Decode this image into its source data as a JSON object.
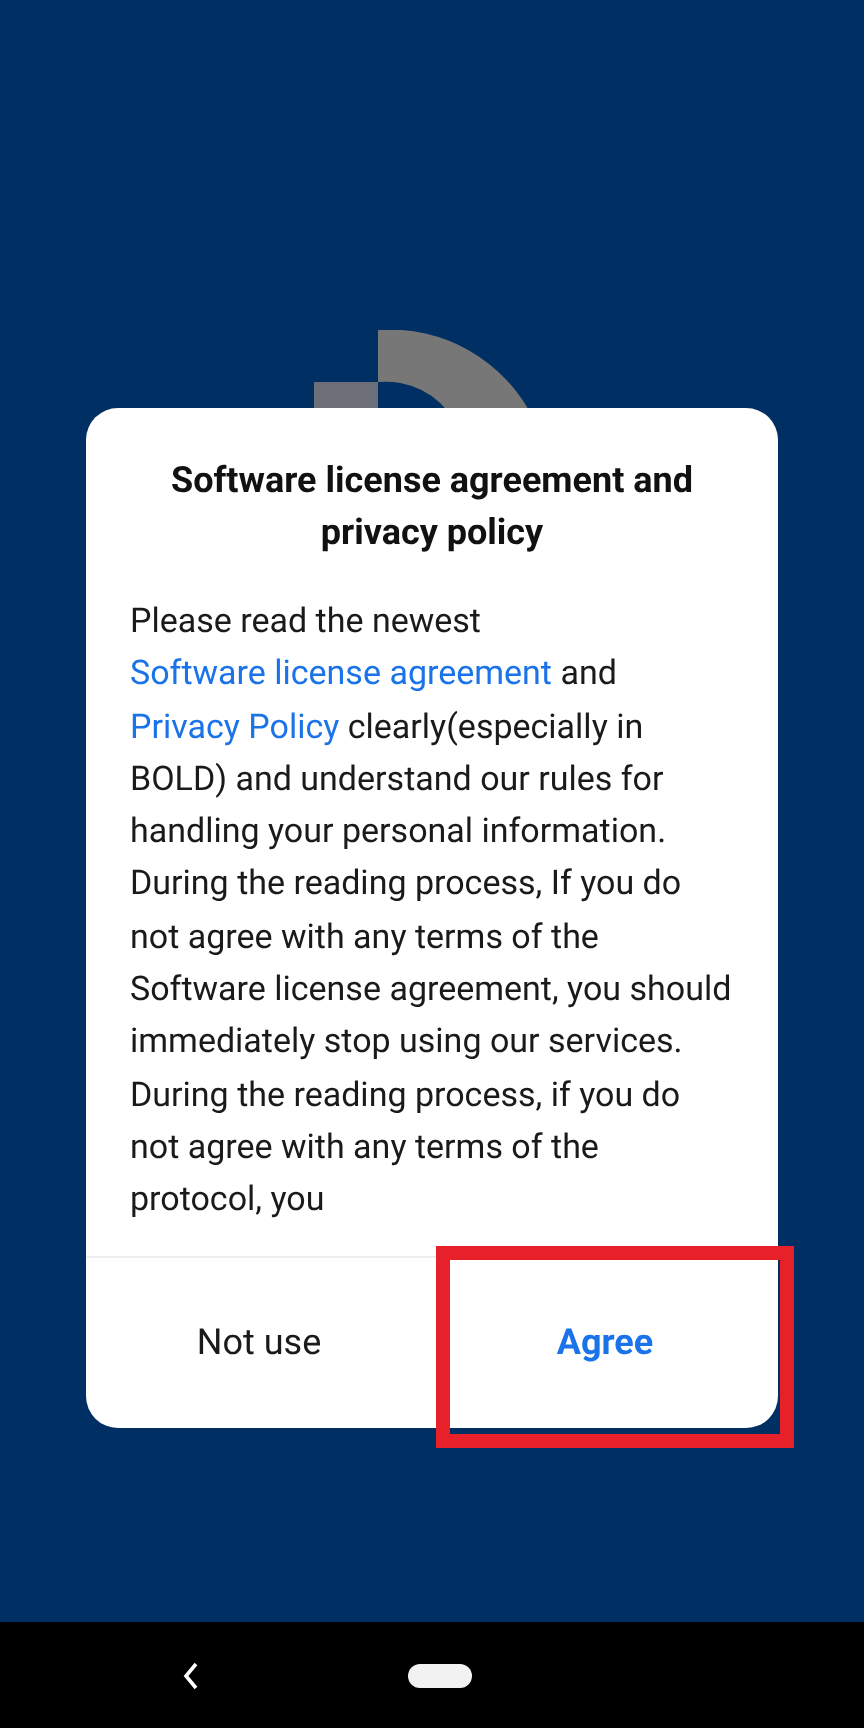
{
  "dialog": {
    "title": "Software license agreement and privacy policy",
    "body": [
      {
        "kind": "text",
        "text": "Please read the newest "
      },
      {
        "kind": "link",
        "text": "Software license agreement"
      },
      {
        "kind": "text",
        "text": " and "
      },
      {
        "kind": "link",
        "text": "Privacy Policy"
      },
      {
        "kind": "text",
        "text": " clearly(especially in BOLD) and understand our rules for handling your personal information. During the reading process, If you do not agree with any terms of the Software license agreement, you should immediately stop using our services. During the reading process, if you do not agree with any terms of the protocol, you"
      }
    ],
    "buttons": [
      {
        "label": "Not use",
        "kind": "secondary",
        "highlighted": false
      },
      {
        "label": "Agree",
        "kind": "primary",
        "highlighted": true
      }
    ]
  }
}
